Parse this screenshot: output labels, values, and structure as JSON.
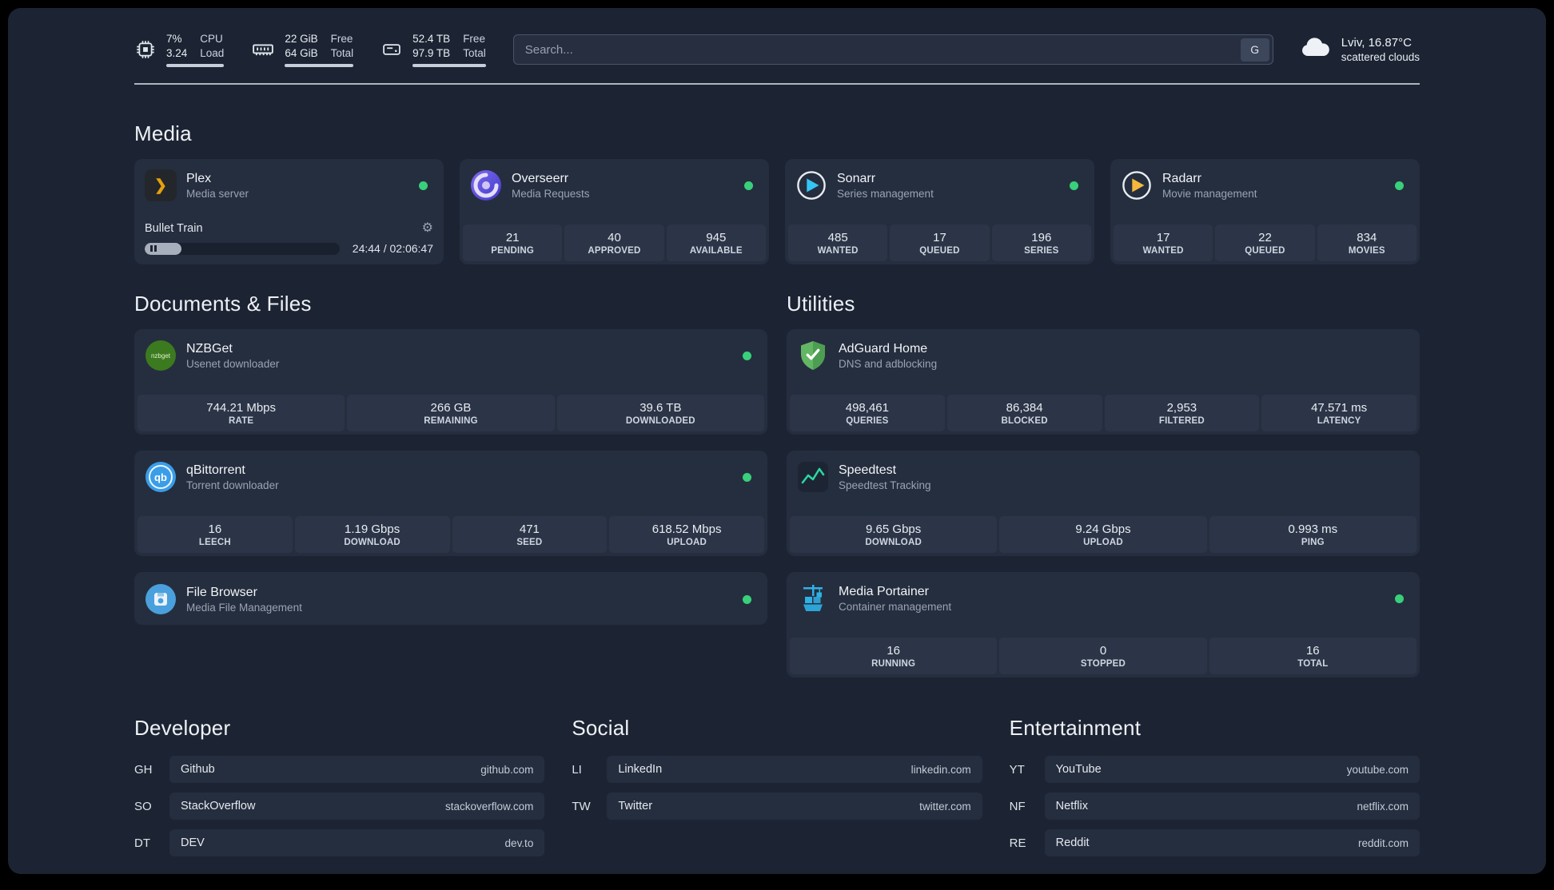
{
  "topbar": {
    "resources": [
      {
        "values": [
          "7%",
          "3.24"
        ],
        "labels": [
          "CPU",
          "Load"
        ]
      },
      {
        "values": [
          "22 GiB",
          "64 GiB"
        ],
        "labels": [
          "Free",
          "Total"
        ]
      },
      {
        "values": [
          "52.4 TB",
          "97.9 TB"
        ],
        "labels": [
          "Free",
          "Total"
        ]
      }
    ],
    "search": {
      "placeholder": "Search...",
      "button_label": "G"
    },
    "weather": {
      "location": "Lviv, 16.87°C",
      "condition": "scattered clouds"
    }
  },
  "sections": {
    "media": "Media",
    "documents": "Documents & Files",
    "utilities": "Utilities"
  },
  "icons": {
    "plex": "❯",
    "gear": "⚙",
    "nzbget_text": "nzbget",
    "qb_text": "qb"
  },
  "services": {
    "plex": {
      "name": "Plex",
      "desc": "Media server",
      "player": {
        "title": "Bullet Train",
        "time": "24:44 / 02:06:47",
        "progress_pct": 19
      }
    },
    "overseerr": {
      "name": "Overseerr",
      "desc": "Media Requests",
      "stats": [
        {
          "value": "21",
          "label": "PENDING"
        },
        {
          "value": "40",
          "label": "APPROVED"
        },
        {
          "value": "945",
          "label": "AVAILABLE"
        }
      ]
    },
    "sonarr": {
      "name": "Sonarr",
      "desc": "Series management",
      "stats": [
        {
          "value": "485",
          "label": "WANTED"
        },
        {
          "value": "17",
          "label": "QUEUED"
        },
        {
          "value": "196",
          "label": "SERIES"
        }
      ]
    },
    "radarr": {
      "name": "Radarr",
      "desc": "Movie management",
      "stats": [
        {
          "value": "17",
          "label": "WANTED"
        },
        {
          "value": "22",
          "label": "QUEUED"
        },
        {
          "value": "834",
          "label": "MOVIES"
        }
      ]
    },
    "nzbget": {
      "name": "NZBGet",
      "desc": "Usenet downloader",
      "stats": [
        {
          "value": "744.21 Mbps",
          "label": "RATE"
        },
        {
          "value": "266 GB",
          "label": "REMAINING"
        },
        {
          "value": "39.6 TB",
          "label": "DOWNLOADED"
        }
      ]
    },
    "qbittorrent": {
      "name": "qBittorrent",
      "desc": "Torrent downloader",
      "stats": [
        {
          "value": "16",
          "label": "LEECH"
        },
        {
          "value": "1.19 Gbps",
          "label": "DOWNLOAD"
        },
        {
          "value": "471",
          "label": "SEED"
        },
        {
          "value": "618.52 Mbps",
          "label": "UPLOAD"
        }
      ]
    },
    "filebrowser": {
      "name": "File Browser",
      "desc": "Media File Management"
    },
    "adguard": {
      "name": "AdGuard Home",
      "desc": "DNS and adblocking",
      "stats": [
        {
          "value": "498,461",
          "label": "QUERIES"
        },
        {
          "value": "86,384",
          "label": "BLOCKED"
        },
        {
          "value": "2,953",
          "label": "FILTERED"
        },
        {
          "value": "47.571 ms",
          "label": "LATENCY"
        }
      ]
    },
    "speedtest": {
      "name": "Speedtest",
      "desc": "Speedtest Tracking",
      "stats": [
        {
          "value": "9.65 Gbps",
          "label": "DOWNLOAD"
        },
        {
          "value": "9.24 Gbps",
          "label": "UPLOAD"
        },
        {
          "value": "0.993 ms",
          "label": "PING"
        }
      ]
    },
    "portainer": {
      "name": "Media Portainer",
      "desc": "Container management",
      "stats": [
        {
          "value": "16",
          "label": "RUNNING"
        },
        {
          "value": "0",
          "label": "STOPPED"
        },
        {
          "value": "16",
          "label": "TOTAL"
        }
      ]
    }
  },
  "bookmarks": [
    {
      "title": "Developer",
      "items": [
        {
          "abbr": "GH",
          "name": "Github",
          "url": "github.com"
        },
        {
          "abbr": "SO",
          "name": "StackOverflow",
          "url": "stackoverflow.com"
        },
        {
          "abbr": "DT",
          "name": "DEV",
          "url": "dev.to"
        }
      ]
    },
    {
      "title": "Social",
      "items": [
        {
          "abbr": "LI",
          "name": "LinkedIn",
          "url": "linkedin.com"
        },
        {
          "abbr": "TW",
          "name": "Twitter",
          "url": "twitter.com"
        }
      ]
    },
    {
      "title": "Entertainment",
      "items": [
        {
          "abbr": "YT",
          "name": "YouTube",
          "url": "youtube.com"
        },
        {
          "abbr": "NF",
          "name": "Netflix",
          "url": "netflix.com"
        },
        {
          "abbr": "RE",
          "name": "Reddit",
          "url": "reddit.com"
        }
      ]
    }
  ]
}
